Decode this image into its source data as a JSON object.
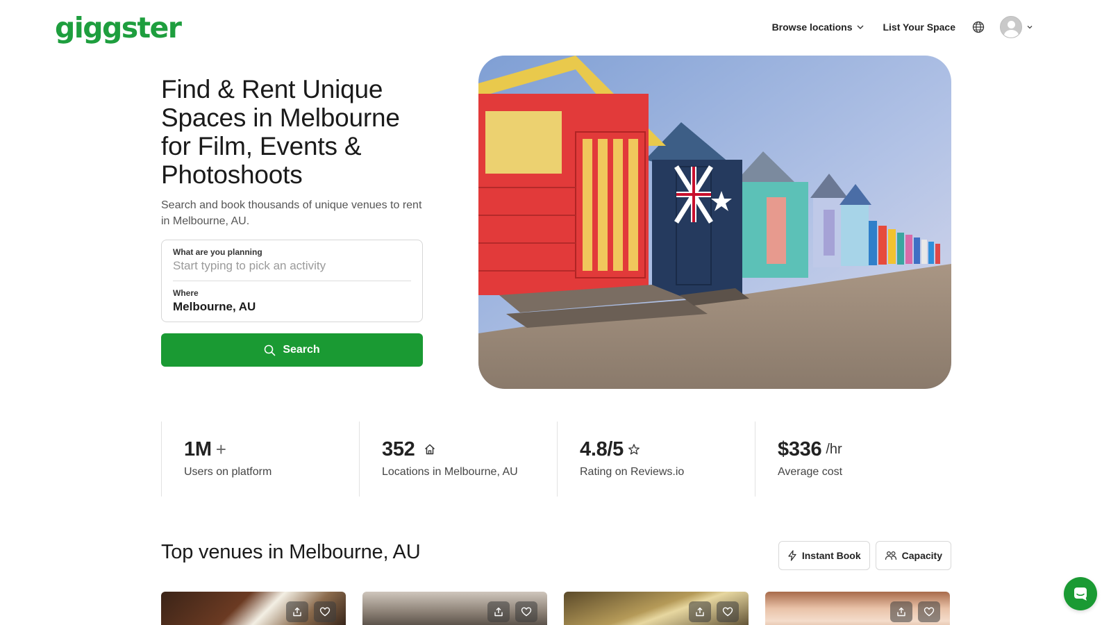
{
  "header": {
    "logo_text": "giggster",
    "nav": {
      "browse_label": "Browse locations",
      "list_label": "List Your Space"
    }
  },
  "hero": {
    "title": "Find & Rent Unique Spaces in Melbourne for Film, Events & Photoshoots",
    "subtitle": "Search and book thousands of unique venues to rent in Melbourne, AU.",
    "search": {
      "activity_label": "What are you planning",
      "activity_placeholder": "Start typing to pick an activity",
      "where_label": "Where",
      "where_value": "Melbourne, AU",
      "button_label": "Search"
    },
    "image": "melbourne-beach-huts-photo"
  },
  "stats": [
    {
      "value": "1M",
      "unit": "+",
      "icon": "plus",
      "label": "Users on platform"
    },
    {
      "value": "352",
      "unit": "",
      "icon": "home-icon",
      "label": "Locations in Melbourne, AU"
    },
    {
      "value": "4.8/5",
      "unit": "",
      "icon": "star-icon",
      "label": "Rating on Reviews.io"
    },
    {
      "value": "$336",
      "unit": "/hr",
      "icon": "",
      "label": "Average cost"
    }
  ],
  "venues_section": {
    "title": "Top venues in Melbourne, AU",
    "filters": {
      "instant_label": "Instant Book",
      "capacity_label": "Capacity"
    },
    "cards": [
      {
        "image": "venue-photo-dark-interior"
      },
      {
        "image": "venue-photo-ceiling-lights"
      },
      {
        "image": "venue-photo-warm-room"
      },
      {
        "image": "venue-photo-peach-ceiling"
      }
    ]
  },
  "colors": {
    "brand_green": "#1a9a33",
    "logo_green": "#1e9e3e",
    "text_dark": "#1a1a1a"
  }
}
